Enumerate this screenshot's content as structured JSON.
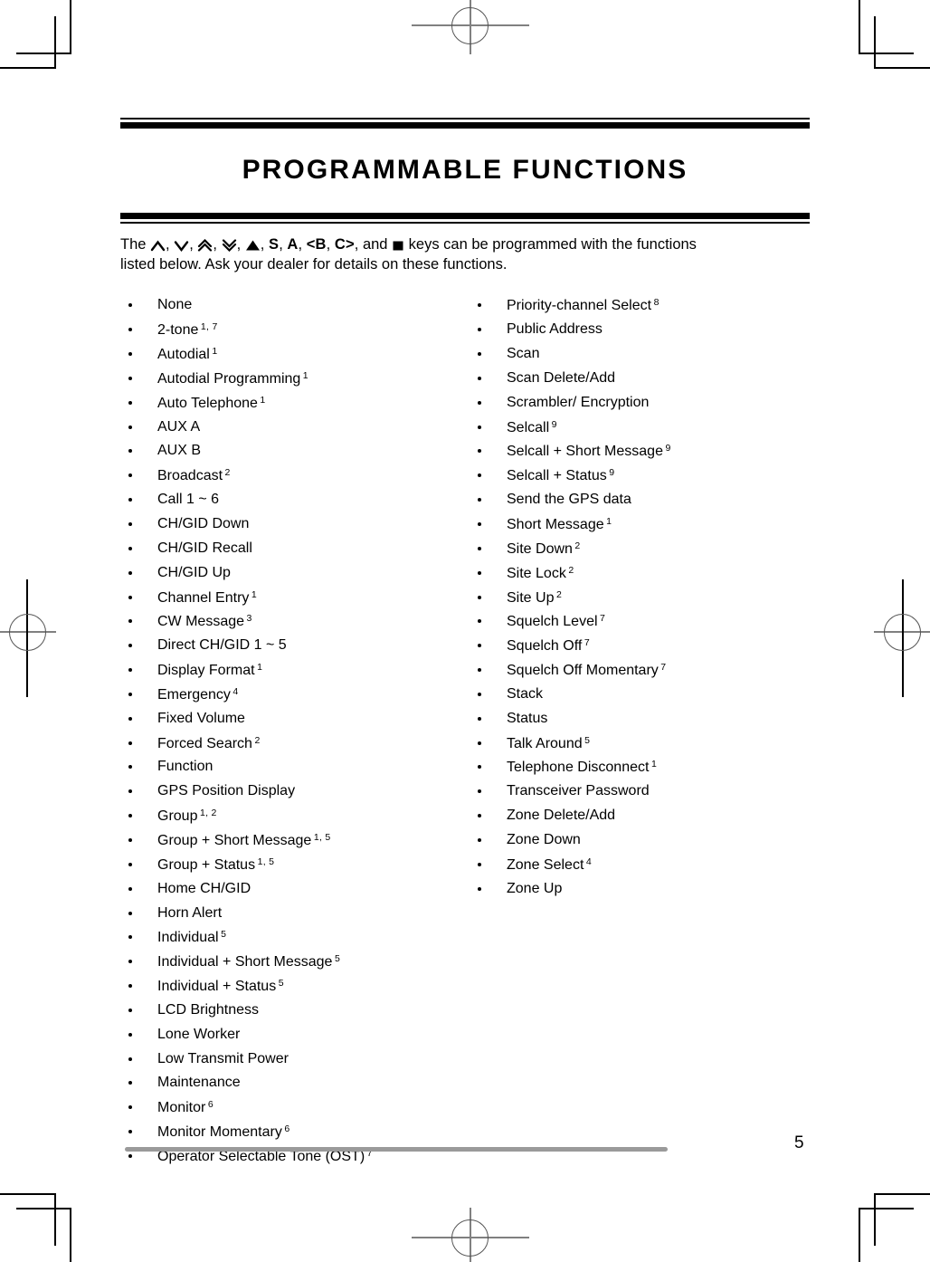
{
  "document": {
    "title": "PROGRAMMABLE FUNCTIONS",
    "page_number": "5"
  },
  "intro": {
    "lead": "The",
    "key_symbols": [
      {
        "name": "chevron-up-icon",
        "label": "∧"
      },
      {
        "name": "chevron-down-icon",
        "label": "∨"
      },
      {
        "name": "double-chevron-up-icon",
        "label": "«"
      },
      {
        "name": "double-chevron-down-icon",
        "label": "»"
      },
      {
        "name": "filled-triangle-icon",
        "label": "▲"
      },
      {
        "name": "key-s-label",
        "label": "S"
      },
      {
        "name": "key-a-label",
        "label": "A"
      },
      {
        "name": "key-b-label",
        "label": "<B"
      },
      {
        "name": "key-c-label",
        "label": "C>"
      },
      {
        "name": "filled-square-icon",
        "label": "■"
      }
    ],
    "conjunction": ", and",
    "sentence_tail": "keys can be programmed with the functions",
    "line_two": "listed below.  Ask your dealer for details on these functions."
  },
  "functions": {
    "left_column": [
      {
        "label": "None",
        "note": ""
      },
      {
        "label": "2-tone",
        "note": "1, 7"
      },
      {
        "label": "Autodial",
        "note": "1"
      },
      {
        "label": "Autodial Programming",
        "note": "1"
      },
      {
        "label": "Auto Telephone",
        "note": "1"
      },
      {
        "label": "AUX A",
        "note": ""
      },
      {
        "label": "AUX B",
        "note": ""
      },
      {
        "label": "Broadcast",
        "note": "2"
      },
      {
        "label": "Call 1 ~ 6",
        "note": ""
      },
      {
        "label": "CH/GID Down",
        "note": ""
      },
      {
        "label": "CH/GID Recall",
        "note": ""
      },
      {
        "label": "CH/GID Up",
        "note": ""
      },
      {
        "label": "Channel Entry",
        "note": "1"
      },
      {
        "label": "CW Message",
        "note": "3"
      },
      {
        "label": "Direct CH/GID 1 ~ 5",
        "note": ""
      },
      {
        "label": "Display Format",
        "note": "1"
      },
      {
        "label": "Emergency",
        "note": "4"
      },
      {
        "label": "Fixed Volume",
        "note": ""
      },
      {
        "label": "Forced Search",
        "note": "2"
      },
      {
        "label": "Function",
        "note": ""
      },
      {
        "label": "GPS Position Display",
        "note": ""
      },
      {
        "label": "Group",
        "note": "1, 2"
      },
      {
        "label": "Group + Short Message",
        "note": "1, 5"
      },
      {
        "label": "Group + Status",
        "note": "1, 5"
      },
      {
        "label": "Home CH/GID",
        "note": ""
      },
      {
        "label": "Horn Alert",
        "note": ""
      },
      {
        "label": "Individual",
        "note": "5"
      },
      {
        "label": "Individual + Short Message",
        "note": "5"
      },
      {
        "label": "Individual + Status",
        "note": "5"
      },
      {
        "label": "LCD Brightness",
        "note": ""
      },
      {
        "label": "Lone Worker",
        "note": ""
      },
      {
        "label": "Low Transmit Power",
        "note": ""
      },
      {
        "label": "Maintenance",
        "note": ""
      },
      {
        "label": "Monitor",
        "note": "6"
      },
      {
        "label": "Monitor Momentary",
        "note": "6"
      },
      {
        "label": "Operator Selectable Tone (OST)",
        "note": "7"
      }
    ],
    "right_column": [
      {
        "label": "Priority-channel Select",
        "note": "8"
      },
      {
        "label": "Public Address",
        "note": ""
      },
      {
        "label": "Scan",
        "note": ""
      },
      {
        "label": "Scan Delete/Add",
        "note": ""
      },
      {
        "label": "Scrambler/ Encryption",
        "note": ""
      },
      {
        "label": "Selcall",
        "note": "9"
      },
      {
        "label": "Selcall + Short Message",
        "note": "9"
      },
      {
        "label": "Selcall + Status",
        "note": "9"
      },
      {
        "label": "Send the GPS data",
        "note": ""
      },
      {
        "label": "Short Message",
        "note": "1"
      },
      {
        "label": "Site Down",
        "note": "2"
      },
      {
        "label": "Site Lock",
        "note": "2"
      },
      {
        "label": "Site Up",
        "note": "2"
      },
      {
        "label": "Squelch Level",
        "note": "7"
      },
      {
        "label": "Squelch Off",
        "note": "7"
      },
      {
        "label": "Squelch Off Momentary",
        "note": "7"
      },
      {
        "label": "Stack",
        "note": ""
      },
      {
        "label": "Status",
        "note": ""
      },
      {
        "label": "Talk Around",
        "note": "5"
      },
      {
        "label": "Telephone Disconnect",
        "note": "1"
      },
      {
        "label": "Transceiver Password",
        "note": ""
      },
      {
        "label": "Zone Delete/Add",
        "note": ""
      },
      {
        "label": "Zone Down",
        "note": ""
      },
      {
        "label": "Zone Select",
        "note": "4"
      },
      {
        "label": "Zone Up",
        "note": ""
      }
    ]
  }
}
